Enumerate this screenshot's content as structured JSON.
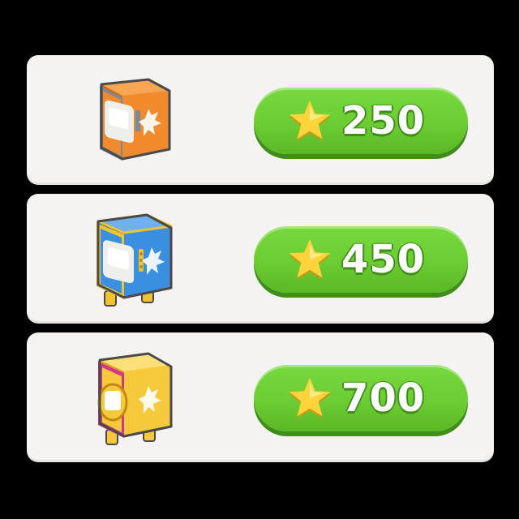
{
  "offers": [
    {
      "price": "250",
      "icon": "orange-safe-icon",
      "colors": {
        "body": "#f08a2c",
        "body_dark": "#d36a1a",
        "trim": "#7a8a96",
        "door": "#eeeeea"
      }
    },
    {
      "price": "450",
      "icon": "blue-safe-icon",
      "colors": {
        "body": "#3b8fe0",
        "body_dark": "#2766b5",
        "trim": "#f2c230",
        "door": "#eeeeea"
      }
    },
    {
      "price": "700",
      "icon": "gold-safe-icon",
      "colors": {
        "body": "#f5c93a",
        "body_dark": "#d9a41c",
        "trim": "#d8348f",
        "door": "#eeeeea"
      }
    }
  ],
  "colors": {
    "panel": "#f4f3f1",
    "button": "#6ccc32",
    "button_shadow": "#3f8e1a",
    "star": "#ffd43a",
    "background": "#000000"
  }
}
